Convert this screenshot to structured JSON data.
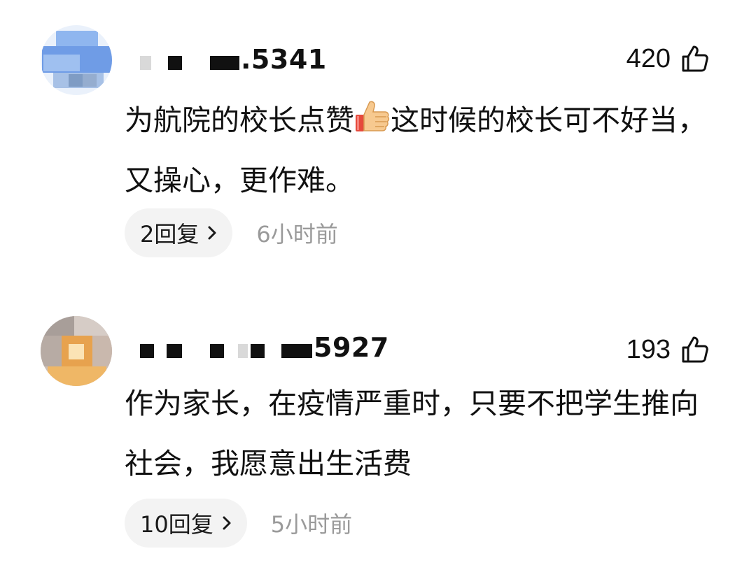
{
  "comments": [
    {
      "username_suffix": ".5341",
      "likes": "420",
      "content_part1": "为航院的校长点赞",
      "emoji": "thumbs-up-emoji",
      "content_part2": "这时候的校长可不好当，又操心，更作难。",
      "replies_label": "2回复",
      "time": "6小时前"
    },
    {
      "username_suffix": "5927",
      "likes": "193",
      "content": "作为家长，在疫情严重时，只要不把学生推向社会，我愿意出生活费",
      "replies_label": "10回复",
      "time": "5小时前"
    }
  ],
  "icons": {
    "like": "thumb-up-outline-icon",
    "chevron": "chevron-right-icon"
  },
  "colors": {
    "text": "#111111",
    "muted": "#9a9a9a",
    "pill_bg": "#f3f3f3"
  }
}
